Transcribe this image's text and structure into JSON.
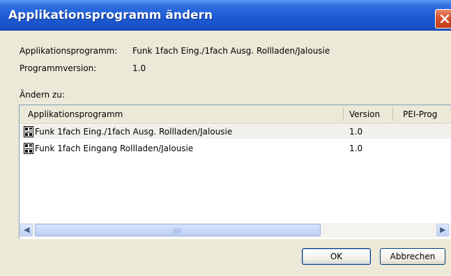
{
  "window": {
    "title": "Applikationsprogramm ändern"
  },
  "info": {
    "app_label": "Applikationsprogramm:",
    "app_value": "Funk 1fach Eing./1fach Ausg. Rollladen/Jalousie",
    "version_label": "Programmversion:",
    "version_value": "1.0"
  },
  "change_to_label": "Ändern zu:",
  "list": {
    "columns": [
      "Applikationsprogramm",
      "Version",
      "PEI-Prog"
    ],
    "rows": [
      {
        "name": "Funk 1fach Eing./1fach Ausg. Rollladen/Jalousie",
        "version": "1.0",
        "pei": ""
      },
      {
        "name": "Funk 1fach Eingang Rollladen/Jalousie",
        "version": "1.0",
        "pei": ""
      }
    ]
  },
  "buttons": {
    "ok": "OK",
    "cancel": "Abbrechen"
  },
  "icons": [
    "close-icon",
    "application-program-icon",
    "scroll-left-icon",
    "scroll-right-icon"
  ]
}
